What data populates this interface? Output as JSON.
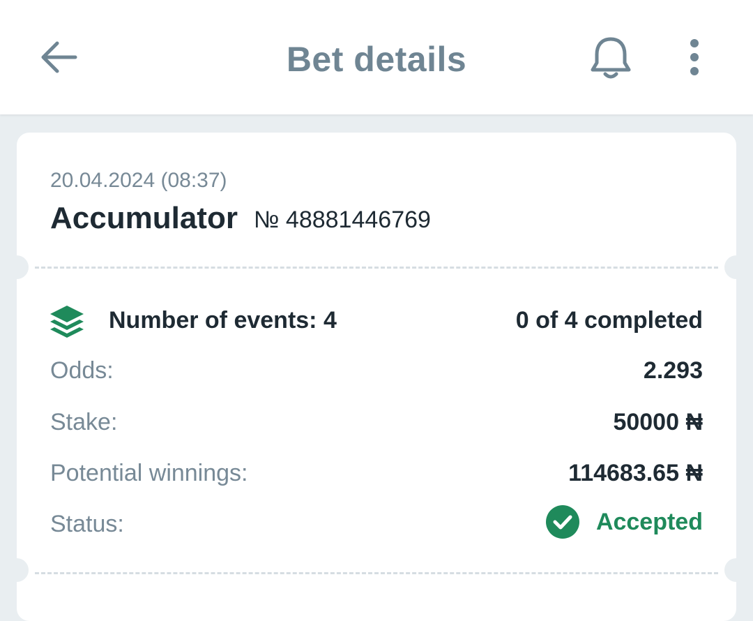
{
  "header": {
    "title": "Bet details",
    "back_icon": "arrow-left-icon",
    "bell_icon": "bell-icon",
    "menu_icon": "more-vertical-icon"
  },
  "bet": {
    "date": "20.04.2024 (08:37)",
    "type": "Accumulator",
    "number": "№ 48881446769",
    "events_label": "Number of events: 4",
    "events_progress": "0 of 4 completed",
    "events_icon": "layers-icon",
    "rows": [
      {
        "label": "Odds:",
        "value": "2.293"
      },
      {
        "label": "Stake:",
        "value": "50000 ₦"
      },
      {
        "label": "Potential winnings:",
        "value": "114683.65 ₦"
      }
    ],
    "status_label": "Status:",
    "status_value": "Accepted",
    "status_icon": "check-circle-icon"
  },
  "colors": {
    "accent_green": "#1f8a5b",
    "title_gray": "#6f8593",
    "background": "#e9eef1"
  }
}
